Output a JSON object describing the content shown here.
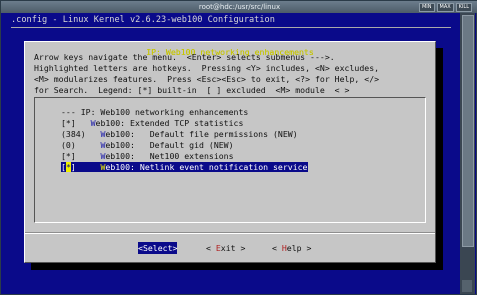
{
  "window": {
    "title": "root@hdc:/usr/src/linux",
    "buttons": [
      "MIN",
      "MAX",
      "KILL"
    ]
  },
  "kconfig": {
    "header": ".config - Linux Kernel v2.6.23-web100 Configuration"
  },
  "dialog": {
    "title": "IP: Web100 networking enhancements",
    "help_lines": [
      "Arrow keys navigate the menu.  <Enter> selects submenus --->.",
      "Highlighted letters are hotkeys.  Pressing <Y> includes, <N> excludes,",
      "<M> modularizes features.  Press <Esc><Esc> to exit, <?> for Help, </>",
      "for Search.  Legend: [*] built-in  [ ] excluded  <M> module  < >"
    ],
    "menu_items": [
      {
        "prefix": "--- ",
        "key": "",
        "text": "IP: Web100 networking enhancements"
      },
      {
        "prefix": "[*]   ",
        "key": "W",
        "text": "eb100: Extended TCP statistics"
      },
      {
        "prefix": "(384)   ",
        "key": "W",
        "text": "eb100:   Default file permissions (NEW)"
      },
      {
        "prefix": "(0)     ",
        "key": "W",
        "text": "eb100:   Default gid (NEW)"
      },
      {
        "prefix": "[*]     ",
        "key": "W",
        "text": "eb100:   Net100 extensions"
      },
      {
        "prefix": "[",
        "cursor": "*",
        "prefix2": "]     ",
        "key": "W",
        "text": "eb100: Netlink event notification service"
      }
    ],
    "selected_index": 5,
    "buttons": {
      "select": {
        "open": "<",
        "key": "S",
        "rest": "elect",
        "close": ">"
      },
      "exit": {
        "open": "< ",
        "key": "E",
        "rest": "xit",
        "close": " >"
      },
      "help": {
        "open": "< ",
        "key": "H",
        "rest": "elp",
        "close": " >"
      }
    }
  },
  "colors": {
    "background": "#0a0a8a",
    "dialog": "#c6c6c6",
    "title": "#c8c800",
    "highlight": "#0a0a8a",
    "hotkey": "#1a1aa8"
  }
}
